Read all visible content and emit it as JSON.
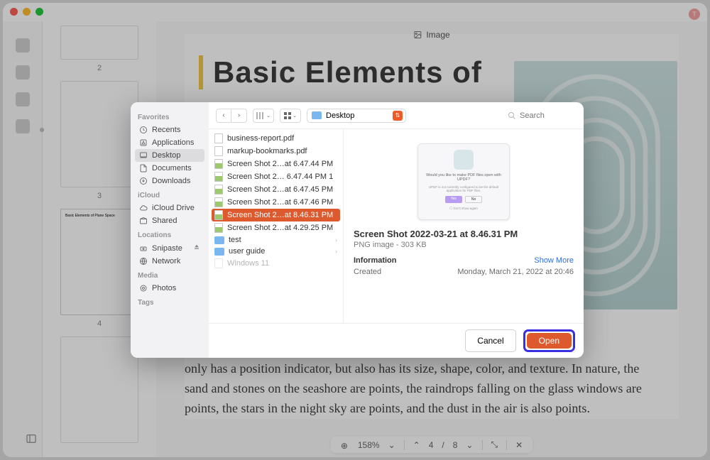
{
  "window": {
    "user_initial": "T"
  },
  "rail": {
    "icons": [
      "panel",
      "highlighter",
      "note",
      "stamp"
    ]
  },
  "thumbs": {
    "nums": [
      "2",
      "3",
      "4"
    ]
  },
  "doc": {
    "top_tab": "Image",
    "h1": "Basic Elements of",
    "body": "only has a position indicator, but also has its size, shape, color, and texture. In nature, the sand and stones on the seashore are points, the raindrops falling on the glass windows are points, the stars in the night sky are points, and the dust in the air is also points.",
    "toolbar": {
      "zoom": "158%",
      "page_cur": "4",
      "page_sep": "/",
      "page_total": "8"
    }
  },
  "dialog": {
    "sidebar": {
      "favorites_hdr": "Favorites",
      "favorites": [
        {
          "icon": "clock",
          "label": "Recents"
        },
        {
          "icon": "app",
          "label": "Applications"
        },
        {
          "icon": "desktop",
          "label": "Desktop",
          "selected": true
        },
        {
          "icon": "doc",
          "label": "Documents"
        },
        {
          "icon": "download",
          "label": "Downloads"
        }
      ],
      "icloud_hdr": "iCloud",
      "icloud": [
        {
          "icon": "cloud",
          "label": "iCloud Drive"
        },
        {
          "icon": "shared",
          "label": "Shared"
        }
      ],
      "locations_hdr": "Locations",
      "locations": [
        {
          "icon": "drive",
          "label": "Snipaste",
          "eject": true
        },
        {
          "icon": "globe",
          "label": "Network"
        }
      ],
      "media_hdr": "Media",
      "media": [
        {
          "icon": "photos",
          "label": "Photos"
        }
      ],
      "tags_hdr": "Tags"
    },
    "location_label": "Desktop",
    "search_placeholder": "Search",
    "files": [
      {
        "kind": "pdf",
        "name": "business-report.pdf"
      },
      {
        "kind": "pdf",
        "name": "markup-bookmarks.pdf"
      },
      {
        "kind": "img",
        "name": "Screen Shot 2…at 6.47.44 PM"
      },
      {
        "kind": "img",
        "name": "Screen Shot 2… 6.47.44 PM 1"
      },
      {
        "kind": "img",
        "name": "Screen Shot 2…at 6.47.45 PM"
      },
      {
        "kind": "img",
        "name": "Screen Shot 2…at 6.47.46 PM"
      },
      {
        "kind": "img",
        "name": "Screen Shot 2…at 8.46.31 PM",
        "selected": true
      },
      {
        "kind": "img",
        "name": "Screen Shot 2…at 4.29.25 PM"
      },
      {
        "kind": "folder",
        "name": "test",
        "child": true
      },
      {
        "kind": "folder",
        "name": "user guide",
        "child": true
      },
      {
        "kind": "dim",
        "name": "Windows 11"
      }
    ],
    "preview": {
      "inner_q": "Would you like to make PDF files open with UPDF?",
      "inner_sub": "UPDF is not currently configured to be the default application for PDF files.",
      "inner_yes": "Yes",
      "inner_no": "No",
      "inner_dont": "☐ Don't show again",
      "title": "Screen Shot 2022-03-21 at 8.46.31 PM",
      "subtitle": "PNG image - 303 KB",
      "info_hdr": "Information",
      "show_more": "Show More",
      "created_k": "Created",
      "created_v": "Monday, March 21, 2022 at 20:46"
    },
    "cancel": "Cancel",
    "open": "Open"
  }
}
